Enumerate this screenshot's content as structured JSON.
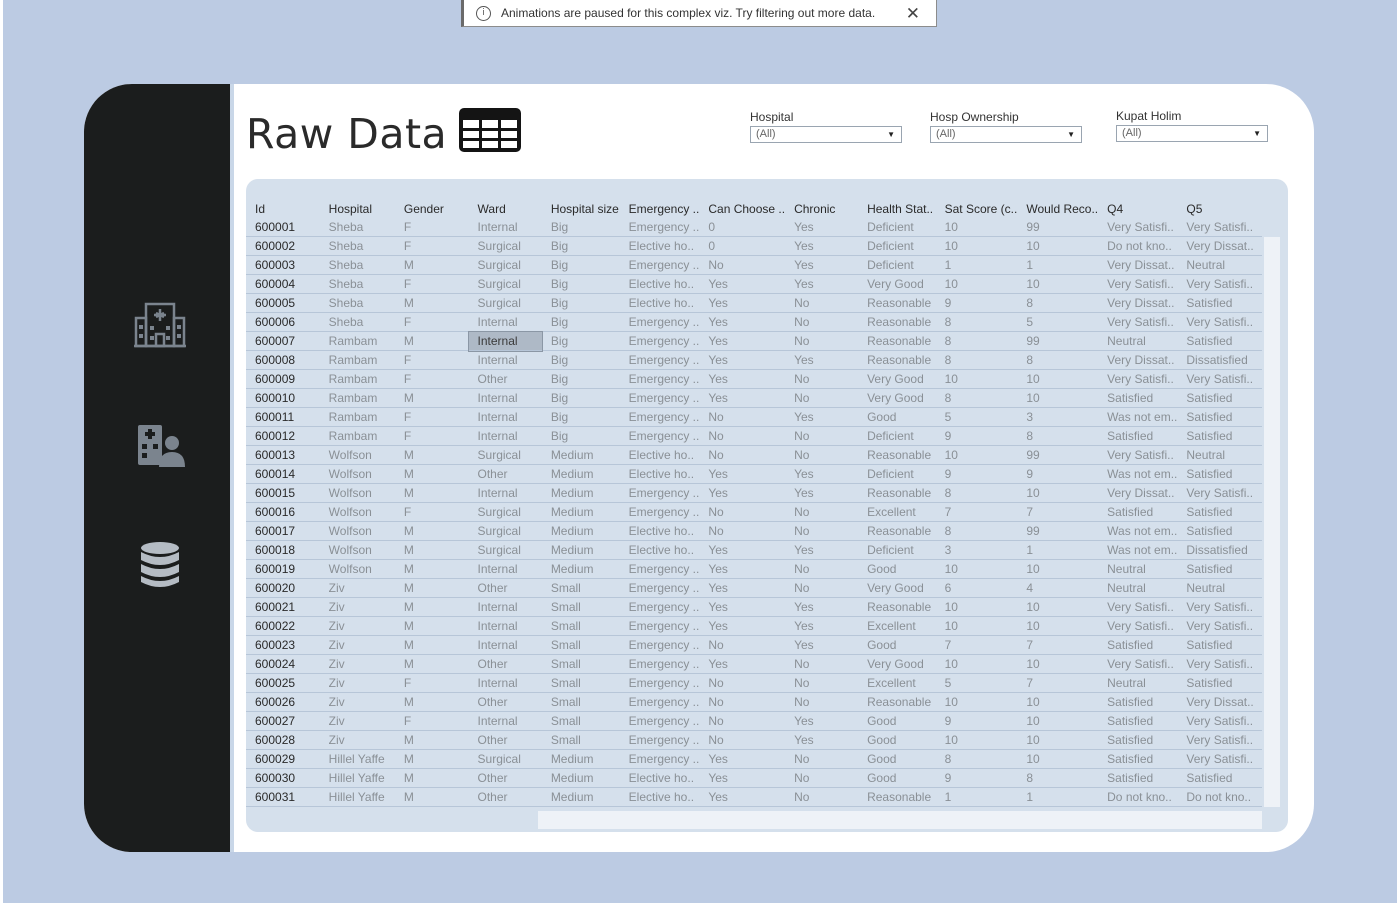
{
  "toast": {
    "message": "Animations are paused for this complex viz. Try filtering out more data.",
    "close_label": "✕",
    "info_label": "i"
  },
  "page": {
    "title": "Raw Data"
  },
  "sidebar": {
    "items": [
      {
        "name": "hospital-icon"
      },
      {
        "name": "hospital-patient-icon"
      },
      {
        "name": "database-icon"
      }
    ]
  },
  "filters": [
    {
      "label": "Hospital",
      "value": "(All)"
    },
    {
      "label": "Hosp Ownership",
      "value": "(All)"
    },
    {
      "label": "Kupat Holim",
      "value": "(All)"
    }
  ],
  "table": {
    "columns": [
      "Id",
      "Hospital",
      "Gender",
      "Ward",
      "Hospital size",
      "Emergency ..",
      "Can Choose ..",
      "Chronic",
      "Health Stat..",
      "Sat Score (c..",
      "Would Reco..",
      "Q4",
      "Q5"
    ],
    "highlighted_cell": {
      "row": 6,
      "col": 3
    },
    "rows": [
      [
        "600001",
        "Sheba",
        "F",
        "Internal",
        "Big",
        "Emergency ..",
        "0",
        "Yes",
        "Deficient",
        "10",
        "99",
        "Very Satisfi..",
        "Very Satisfi.."
      ],
      [
        "600002",
        "Sheba",
        "F",
        "Surgical",
        "Big",
        "Elective ho..",
        "0",
        "Yes",
        "Deficient",
        "10",
        "10",
        "Do not kno..",
        "Very Dissat.."
      ],
      [
        "600003",
        "Sheba",
        "M",
        "Surgical",
        "Big",
        "Emergency ..",
        "No",
        "Yes",
        "Deficient",
        "1",
        "1",
        "Very Dissat..",
        "Neutral"
      ],
      [
        "600004",
        "Sheba",
        "F",
        "Surgical",
        "Big",
        "Elective ho..",
        "Yes",
        "Yes",
        "Very Good",
        "10",
        "10",
        "Very Satisfi..",
        "Very Satisfi.."
      ],
      [
        "600005",
        "Sheba",
        "M",
        "Surgical",
        "Big",
        "Elective ho..",
        "Yes",
        "No",
        "Reasonable",
        "9",
        "8",
        "Very Dissat..",
        "Satisfied"
      ],
      [
        "600006",
        "Sheba",
        "F",
        "Internal",
        "Big",
        "Emergency ..",
        "Yes",
        "No",
        "Reasonable",
        "8",
        "5",
        "Very Satisfi..",
        "Very Satisfi.."
      ],
      [
        "600007",
        "Rambam",
        "M",
        "Internal",
        "Big",
        "Emergency ..",
        "Yes",
        "No",
        "Reasonable",
        "8",
        "99",
        "Neutral",
        "Satisfied"
      ],
      [
        "600008",
        "Rambam",
        "F",
        "Internal",
        "Big",
        "Emergency ..",
        "Yes",
        "Yes",
        "Reasonable",
        "8",
        "8",
        "Very Dissat..",
        "Dissatisfied"
      ],
      [
        "600009",
        "Rambam",
        "F",
        "Other",
        "Big",
        "Emergency ..",
        "Yes",
        "No",
        "Very Good",
        "10",
        "10",
        "Very Satisfi..",
        "Very Satisfi.."
      ],
      [
        "600010",
        "Rambam",
        "M",
        "Internal",
        "Big",
        "Emergency ..",
        "Yes",
        "No",
        "Very Good",
        "8",
        "10",
        "Satisfied",
        "Satisfied"
      ],
      [
        "600011",
        "Rambam",
        "F",
        "Internal",
        "Big",
        "Emergency ..",
        "No",
        "Yes",
        "Good",
        "5",
        "3",
        "Was not em..",
        "Satisfied"
      ],
      [
        "600012",
        "Rambam",
        "F",
        "Internal",
        "Big",
        "Emergency ..",
        "No",
        "No",
        "Deficient",
        "9",
        "8",
        "Satisfied",
        "Satisfied"
      ],
      [
        "600013",
        "Wolfson",
        "M",
        "Surgical",
        "Medium",
        "Elective ho..",
        "No",
        "No",
        "Reasonable",
        "10",
        "99",
        "Very Satisfi..",
        "Neutral"
      ],
      [
        "600014",
        "Wolfson",
        "M",
        "Other",
        "Medium",
        "Elective ho..",
        "Yes",
        "Yes",
        "Deficient",
        "9",
        "9",
        "Was not em..",
        "Satisfied"
      ],
      [
        "600015",
        "Wolfson",
        "M",
        "Internal",
        "Medium",
        "Emergency ..",
        "Yes",
        "Yes",
        "Reasonable",
        "8",
        "10",
        "Very Dissat..",
        "Very Satisfi.."
      ],
      [
        "600016",
        "Wolfson",
        "F",
        "Surgical",
        "Medium",
        "Emergency ..",
        "No",
        "No",
        "Excellent",
        "7",
        "7",
        "Satisfied",
        "Satisfied"
      ],
      [
        "600017",
        "Wolfson",
        "M",
        "Surgical",
        "Medium",
        "Elective ho..",
        "No",
        "No",
        "Reasonable",
        "8",
        "99",
        "Was not em..",
        "Satisfied"
      ],
      [
        "600018",
        "Wolfson",
        "M",
        "Surgical",
        "Medium",
        "Elective ho..",
        "Yes",
        "Yes",
        "Deficient",
        "3",
        "1",
        "Was not em..",
        "Dissatisfied"
      ],
      [
        "600019",
        "Wolfson",
        "M",
        "Internal",
        "Medium",
        "Emergency ..",
        "Yes",
        "No",
        "Good",
        "10",
        "10",
        "Neutral",
        "Satisfied"
      ],
      [
        "600020",
        "Ziv",
        "M",
        "Other",
        "Small",
        "Emergency ..",
        "Yes",
        "No",
        "Very Good",
        "6",
        "4",
        "Neutral",
        "Neutral"
      ],
      [
        "600021",
        "Ziv",
        "M",
        "Internal",
        "Small",
        "Emergency ..",
        "Yes",
        "Yes",
        "Reasonable",
        "10",
        "10",
        "Very Satisfi..",
        "Very Satisfi.."
      ],
      [
        "600022",
        "Ziv",
        "M",
        "Internal",
        "Small",
        "Emergency ..",
        "Yes",
        "Yes",
        "Excellent",
        "10",
        "10",
        "Very Satisfi..",
        "Very Satisfi.."
      ],
      [
        "600023",
        "Ziv",
        "M",
        "Internal",
        "Small",
        "Emergency ..",
        "No",
        "Yes",
        "Good",
        "7",
        "7",
        "Satisfied",
        "Satisfied"
      ],
      [
        "600024",
        "Ziv",
        "M",
        "Other",
        "Small",
        "Emergency ..",
        "Yes",
        "No",
        "Very Good",
        "10",
        "10",
        "Very Satisfi..",
        "Very Satisfi.."
      ],
      [
        "600025",
        "Ziv",
        "F",
        "Internal",
        "Small",
        "Emergency ..",
        "No",
        "No",
        "Excellent",
        "5",
        "7",
        "Neutral",
        "Satisfied"
      ],
      [
        "600026",
        "Ziv",
        "M",
        "Other",
        "Small",
        "Emergency ..",
        "No",
        "No",
        "Reasonable",
        "10",
        "10",
        "Satisfied",
        "Very Dissat.."
      ],
      [
        "600027",
        "Ziv",
        "F",
        "Internal",
        "Small",
        "Emergency ..",
        "No",
        "Yes",
        "Good",
        "9",
        "10",
        "Satisfied",
        "Very Satisfi.."
      ],
      [
        "600028",
        "Ziv",
        "M",
        "Other",
        "Small",
        "Emergency ..",
        "No",
        "Yes",
        "Good",
        "10",
        "10",
        "Satisfied",
        "Very Satisfi.."
      ],
      [
        "600029",
        "Hillel Yaffe",
        "M",
        "Surgical",
        "Medium",
        "Emergency ..",
        "Yes",
        "No",
        "Good",
        "8",
        "10",
        "Satisfied",
        "Very Satisfi.."
      ],
      [
        "600030",
        "Hillel Yaffe",
        "M",
        "Other",
        "Medium",
        "Elective ho..",
        "Yes",
        "No",
        "Good",
        "9",
        "8",
        "Satisfied",
        "Satisfied"
      ],
      [
        "600031",
        "Hillel Yaffe",
        "M",
        "Other",
        "Medium",
        "Elective ho..",
        "Yes",
        "No",
        "Reasonable",
        "1",
        "1",
        "Do not kno..",
        "Do not kno.."
      ]
    ]
  }
}
